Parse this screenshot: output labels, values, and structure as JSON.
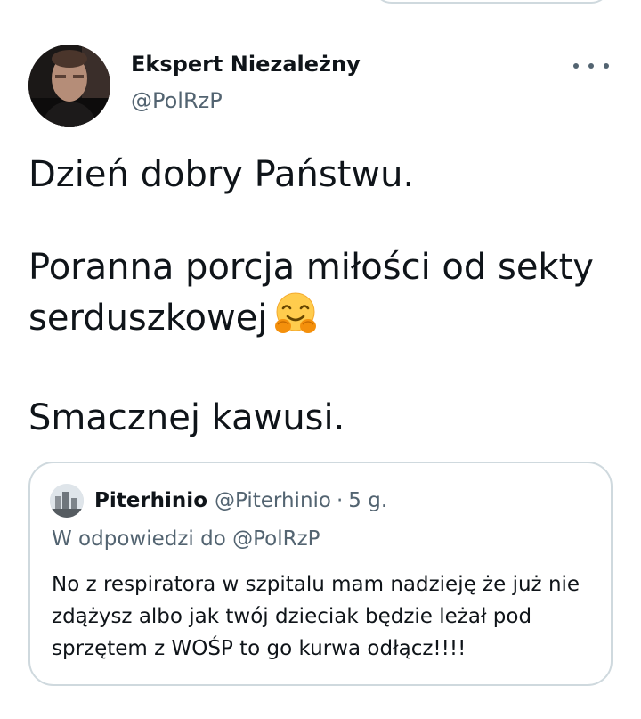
{
  "author": {
    "name": "Ekspert Niezależny",
    "handle": "@PolRzP"
  },
  "tweet": {
    "line1": "Dzień dobry Państwu.",
    "line2": "Poranna porcja miłości od sekty serduszkowej",
    "emoji": "hugging-face-emoji",
    "line3": "Smacznej kawusi."
  },
  "quote": {
    "name": "Piterhinio",
    "handle": "@Piterhinio",
    "separator": "·",
    "time": "5 g.",
    "reply_to": "W odpowiedzi do @PolRzP",
    "text": "No z respiratora w szpitalu mam nadzieję że już nie zdążysz albo jak twój dzieciak będzie leżał pod sprzętem z WOŚP to go kurwa odłącz!!!!"
  },
  "icons": {
    "more": "more-horizontal-icon"
  },
  "colors": {
    "text": "#0f1419",
    "secondary": "#536471",
    "border": "#cfd9de"
  }
}
